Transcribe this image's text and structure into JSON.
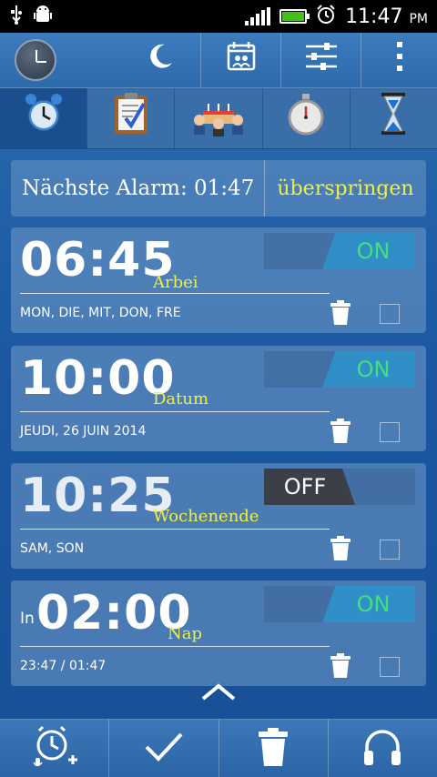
{
  "status_bar": {
    "time": "11:47",
    "ampm": "PM",
    "icons": [
      "usb-icon",
      "android-debug-icon",
      "signal-icon",
      "battery-icon",
      "alarm-icon"
    ]
  },
  "action_bar": {
    "icons": [
      "app-clock-icon",
      "night-mode-icon",
      "calendar-contact-icon",
      "settings-sliders-icon",
      "overflow-menu-icon"
    ]
  },
  "tabs": [
    {
      "icon": "alarm-clock-icon",
      "active": true
    },
    {
      "icon": "clipboard-checklist-icon",
      "active": false
    },
    {
      "icon": "birthday-cake-icon",
      "active": false
    },
    {
      "icon": "stopwatch-icon",
      "active": false
    },
    {
      "icon": "hourglass-icon",
      "active": false
    }
  ],
  "next_alarm": {
    "label": "Nächste Alarm:  01:47",
    "skip_label": "überspringen"
  },
  "alarms": [
    {
      "prefix": "",
      "time": "06:45",
      "name": "Arbei",
      "days": "MON, DIE, MIT, DON, FRE",
      "state": "ON"
    },
    {
      "prefix": "",
      "time": "10:00",
      "name": "Datum",
      "days": "JEUDI, 26 JUIN 2014",
      "state": "ON"
    },
    {
      "prefix": "",
      "time": "10:25",
      "name": "Wochenende",
      "days": "SAM, SON",
      "state": "OFF"
    },
    {
      "prefix": "In",
      "time": "02:00",
      "name": "Nap",
      "days": "23:47 / 01:47",
      "state": "ON"
    }
  ],
  "bottom_bar": {
    "icons": [
      "add-voice-alarm-icon",
      "checkmark-icon",
      "trash-icon",
      "headphones-icon"
    ]
  },
  "colors": {
    "accent_yellow": "#f2f03a",
    "on_green": "#43e07a",
    "on_blue": "#2f8fc6",
    "off_dark": "#3a3f48"
  }
}
